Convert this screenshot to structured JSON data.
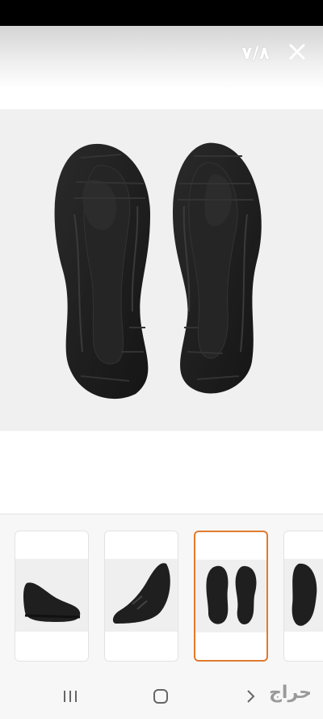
{
  "viewer": {
    "counter": "٧/٨",
    "close_icon": "close-icon"
  },
  "main_image": {
    "icon": "shoe-soles-photo"
  },
  "thumbnails": [
    {
      "name": "shoe-side-view",
      "selected": false
    },
    {
      "name": "shoe-front-angle-view",
      "selected": false
    },
    {
      "name": "shoe-soles-view",
      "selected": true
    },
    {
      "name": "shoe-top-view",
      "selected": false
    }
  ],
  "nav": {
    "recents_icon": "recents-icon",
    "home_icon": "home-icon",
    "back_icon": "back-icon"
  },
  "watermark": "حراج",
  "colors": {
    "accent": "#e07b2e",
    "sole": "#1f1f1f",
    "background": "#f0f0f0"
  }
}
